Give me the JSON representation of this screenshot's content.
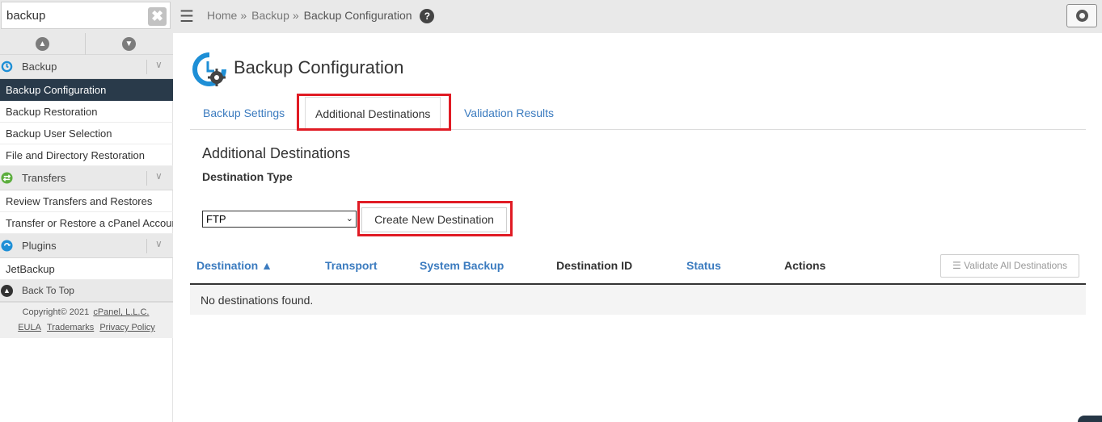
{
  "sidebar": {
    "search": {
      "value": "backup",
      "clear_glyph": "✖"
    },
    "collapse_up_glyph": "▲",
    "collapse_down_glyph": "▼",
    "sections": [
      {
        "label": "Backup",
        "icon": "backup-icon",
        "color": "#1e8fd6",
        "items": [
          "Backup Configuration",
          "Backup Restoration",
          "Backup User Selection",
          "File and Directory Restoration"
        ]
      },
      {
        "label": "Transfers",
        "icon": "transfers-icon",
        "color": "#5cae3e",
        "items": [
          "Review Transfers and Restores",
          "Transfer or Restore a cPanel Account"
        ]
      },
      {
        "label": "Plugins",
        "icon": "plugins-icon",
        "color": "#1e8fd6",
        "items": [
          "JetBackup"
        ]
      }
    ],
    "back_to_top": "Back To Top",
    "footer": {
      "copyright": "Copyright© 2021",
      "company_link": "cPanel, L.L.C.",
      "links": [
        "EULA",
        "Trademarks",
        "Privacy Policy"
      ]
    }
  },
  "topbar": {
    "breadcrumb": [
      "Home",
      "Backup",
      "Backup Configuration"
    ],
    "breadcrumb_sep": "»",
    "help_glyph": "?"
  },
  "main": {
    "title": "Backup Configuration",
    "tabs": [
      "Backup Settings",
      "Additional Destinations",
      "Validation Results"
    ],
    "active_tab": "Additional Destinations",
    "section_title": "Additional Destinations",
    "destination_type_label": "Destination Type",
    "destination_type_value": "FTP",
    "create_button": "Create New Destination",
    "table": {
      "columns": [
        "Destination ▲",
        "Transport",
        "System Backup",
        "Destination ID",
        "Status",
        "Actions"
      ],
      "validate_all": "☰ Validate All Destinations",
      "empty_message": "No destinations found."
    }
  },
  "colors": {
    "link": "#3b7bbf",
    "active_nav": "#293a4a",
    "highlight": "#e01b24"
  }
}
